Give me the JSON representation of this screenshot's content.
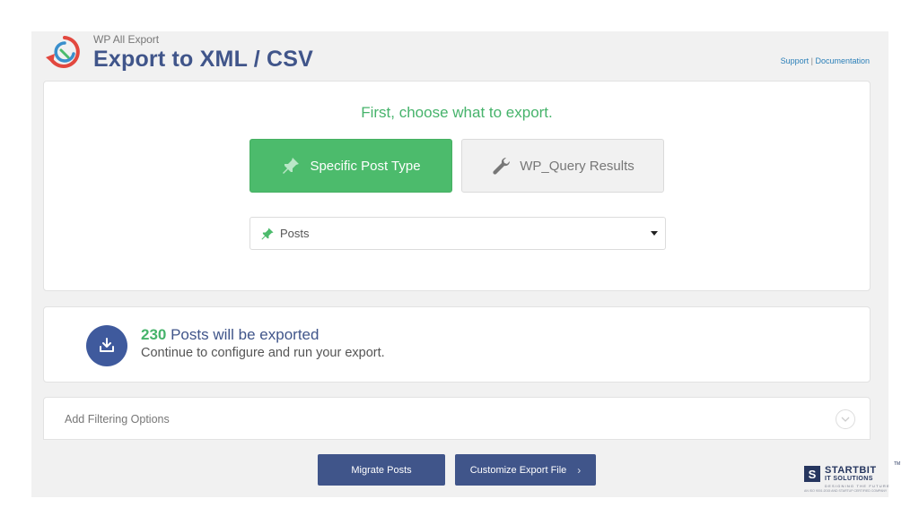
{
  "header": {
    "app_name": "WP All Export",
    "title": "Export to XML / CSV",
    "support_link": "Support",
    "separator": " | ",
    "documentation_link": "Documentation"
  },
  "choose": {
    "heading": "First, choose what to export.",
    "specific_post_type": "Specific Post Type",
    "wp_query_results": "WP_Query Results",
    "selected_post_type": "Posts"
  },
  "summary": {
    "count": "230",
    "count_suffix": " Posts will be exported",
    "subtext": "Continue to configure and run your export."
  },
  "filter": {
    "label": "Add Filtering Options"
  },
  "actions": {
    "migrate": "Migrate Posts",
    "customize": "Customize Export File"
  },
  "watermark": {
    "name": "STARTBIT",
    "tm": "TM",
    "sub": "IT SOLUTIONS",
    "tagline": "DESIGNING THE FUTURE",
    "tiny": "AN ISO 9001:2015 AND STARTUP CERTIFIED COMPANY"
  },
  "colors": {
    "accent_blue": "#40558a",
    "accent_green": "#4cbb6c",
    "link": "#2b7fb8"
  },
  "icons": {
    "logo": "wp-all-export-logo",
    "pin": "pushpin-icon",
    "wrench": "wrench-icon",
    "export": "download-tray-icon",
    "toggle": "chevron-down-icon"
  }
}
